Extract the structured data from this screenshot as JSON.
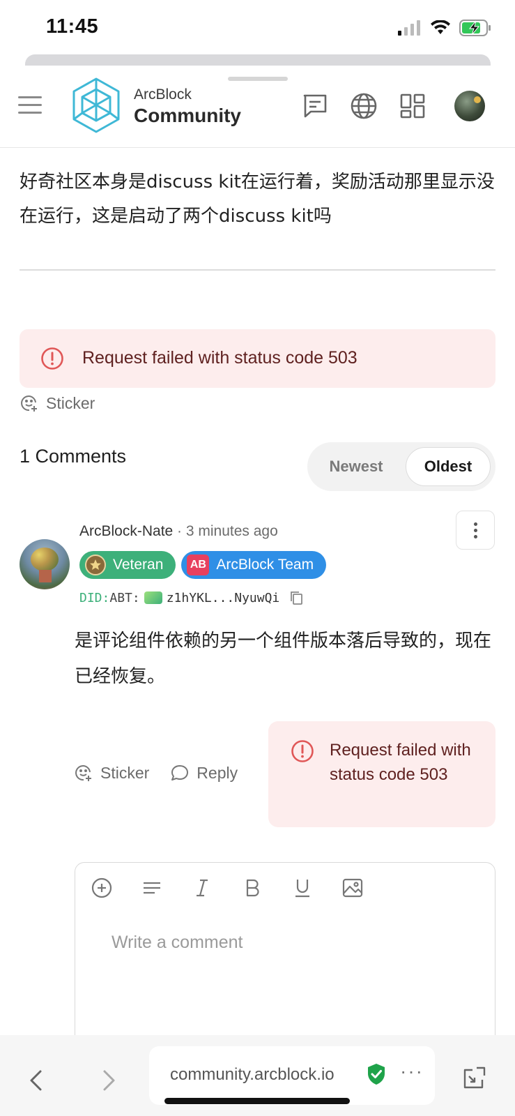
{
  "status_bar": {
    "time": "11:45"
  },
  "header": {
    "brand_top": "ArcBlock",
    "brand_bottom": "Community"
  },
  "post": {
    "text": "好奇社区本身是discuss kit在运行着，奖励活动那里显示没在运行，这是启动了两个discuss kit吗"
  },
  "post_error": {
    "message": "Request failed with status code 503"
  },
  "post_sticker": {
    "label": "Sticker"
  },
  "comments": {
    "title": "1 Comments",
    "sort": {
      "newest": "Newest",
      "oldest": "Oldest",
      "selected": "Oldest"
    },
    "items": [
      {
        "author": "ArcBlock-Nate",
        "separator": " · ",
        "time": "3 minutes ago",
        "badges": [
          {
            "label": "Veteran",
            "color": "#3db07a"
          },
          {
            "label": "ArcBlock Team",
            "icon_text": "AB",
            "color": "#2f8fe6"
          }
        ],
        "did_prefix": "DID:",
        "did_chain": "ABT:",
        "did_value": "z1hYKL...NyuwQi",
        "body": "是评论组件依赖的另一个组件版本落后导致的，现在已经恢复。",
        "actions": {
          "sticker": "Sticker",
          "reply": "Reply"
        },
        "error": "Request failed with status code 503"
      }
    ]
  },
  "editor": {
    "placeholder": "Write a comment"
  },
  "browser": {
    "url": "community.arcblock.io",
    "more": "···"
  },
  "colors": {
    "accent_green": "#3db07a",
    "accent_blue": "#2f8fe6",
    "error_bg": "#fdeded",
    "error_icon": "#e05757"
  }
}
